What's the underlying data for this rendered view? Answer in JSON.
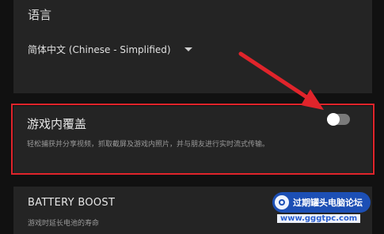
{
  "language_section": {
    "title": "语言",
    "selected_language": "简体中文 (Chinese - Simplified)"
  },
  "in_game_overlay": {
    "title": "游戏内覆盖",
    "description": "轻松捕获并分享视频，抓取截屏及游戏内照片，并与朋友进行实时流式传输。",
    "toggle_state": "off"
  },
  "battery_boost": {
    "title": "BATTERY BOOST",
    "description": "游戏时延长电池的寿命"
  },
  "annotation": {
    "highlight_color": "#e0242b",
    "arrow_color": "#e0242b"
  },
  "watermark": {
    "name": "过期罐头电脑论坛",
    "url": "www.gggtpc.com"
  }
}
